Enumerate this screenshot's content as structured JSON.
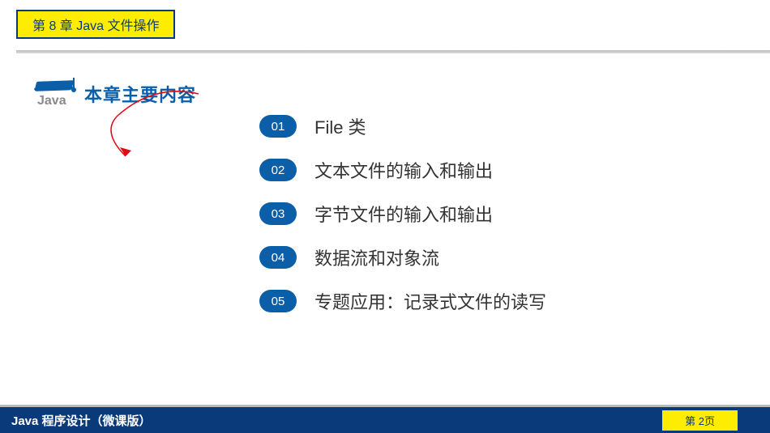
{
  "chapter": {
    "label": "第 8 章  Java 文件操作"
  },
  "icon": {
    "java_label": "Java"
  },
  "heading": "本章主要内容",
  "toc": [
    {
      "num": "01",
      "text": "File 类"
    },
    {
      "num": "02",
      "text": "文本文件的输入和输出"
    },
    {
      "num": "03",
      "text": "字节文件的输入和输出"
    },
    {
      "num": "04",
      "text": "数据流和对象流"
    },
    {
      "num": "05",
      "text": "专题应用：记录式文件的读写"
    }
  ],
  "footer": {
    "title": "Java 程序设计（微课版）",
    "page": "第 2页"
  }
}
